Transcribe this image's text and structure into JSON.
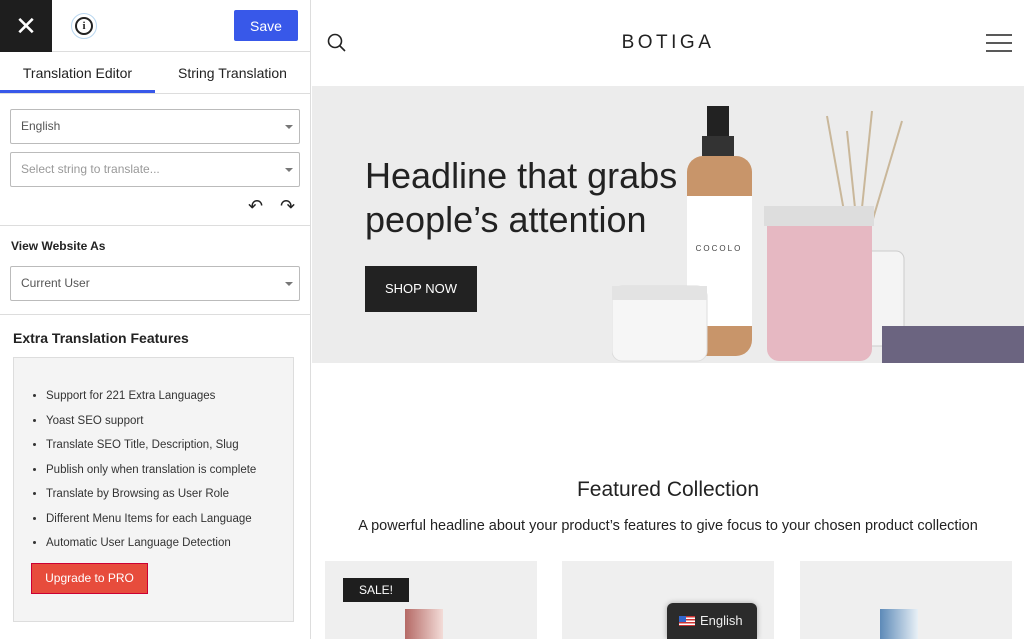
{
  "sidebar": {
    "close_icon": "close-icon",
    "info_icon": "info-icon",
    "save_label": "Save",
    "tabs": [
      "Translation Editor",
      "String Translation"
    ],
    "language_select": "English",
    "string_select_placeholder": "Select string to translate...",
    "view_as_label": "View Website As",
    "view_as_select": "Current User",
    "extra_title": "Extra Translation Features",
    "features": [
      "Support for 221 Extra Languages",
      "Yoast SEO support",
      "Translate SEO Title, Description, Slug",
      "Publish only when translation is complete",
      "Translate by Browsing as User Role",
      "Different Menu Items for each Language",
      "Automatic User Language Detection"
    ],
    "upgrade_label": "Upgrade to PRO"
  },
  "site": {
    "logo": "BOTIGA",
    "hero_line1": "Headline that grabs",
    "hero_line2": "people’s attention",
    "shop_now": "SHOP NOW",
    "jar_label": "COCOLO",
    "featured_title": "Featured Collection",
    "featured_subtitle": "A powerful headline about your product’s features to give focus to your chosen product collection",
    "sale_badge": "SALE!",
    "language_switcher": "English"
  },
  "colors": {
    "accent": "#3858e9",
    "upgrade": "#e74c3c"
  }
}
